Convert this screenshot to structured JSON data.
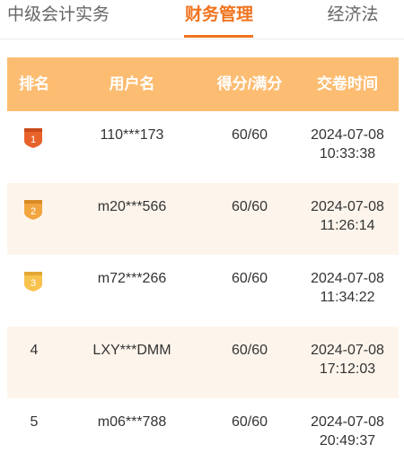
{
  "tabs": [
    {
      "label": "中级会计实务",
      "active": false
    },
    {
      "label": "财务管理",
      "active": true
    },
    {
      "label": "经济法",
      "active": false
    }
  ],
  "colors": {
    "accent": "#f0741f",
    "header_bg": "#fcbd73",
    "alt_row_bg": "#fdf5ec",
    "badge_gold": "#e8632a",
    "badge_silver": "#f2a53f",
    "badge_bronze": "#f7c24e"
  },
  "table": {
    "headers": {
      "rank": "排名",
      "username": "用户名",
      "score": "得分/满分",
      "time": "交卷时间"
    },
    "rows": [
      {
        "rank": "1",
        "badge": "rank-1-medal-icon",
        "username": "110***173",
        "score": "60/60",
        "date": "2024-07-08",
        "time": "10:33:38"
      },
      {
        "rank": "2",
        "badge": "rank-2-medal-icon",
        "username": "m20***566",
        "score": "60/60",
        "date": "2024-07-08",
        "time": "11:26:14"
      },
      {
        "rank": "3",
        "badge": "rank-3-medal-icon",
        "username": "m72***266",
        "score": "60/60",
        "date": "2024-07-08",
        "time": "11:34:22"
      },
      {
        "rank": "4",
        "badge": "",
        "username": "LXY***DMM",
        "score": "60/60",
        "date": "2024-07-08",
        "time": "17:12:03"
      },
      {
        "rank": "5",
        "badge": "",
        "username": "m06***788",
        "score": "60/60",
        "date": "2024-07-08",
        "time": "20:49:37"
      }
    ]
  }
}
